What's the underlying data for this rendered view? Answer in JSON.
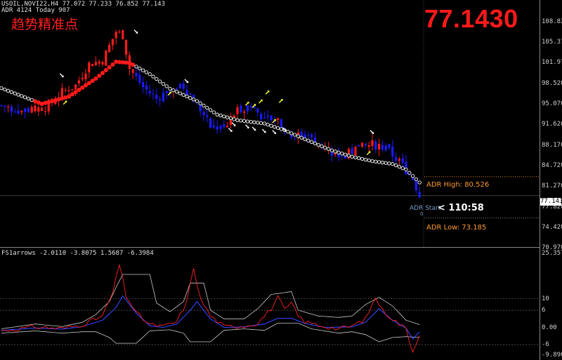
{
  "header": {
    "symbol_line": "USOIL,NOVI22,H4  77.072 77.233 76.852 77.143",
    "adr_line": "ADR 4124  Today 907",
    "indicator_line": "FS1arrows -2.0110 -3.8075 1.5687 -6.3984"
  },
  "big_price": "77.1430",
  "chinese_title": "趋势精准点",
  "price_axis": {
    "ticks": [
      "108.820",
      "105.370",
      "101.970",
      "98.520",
      "95.070",
      "91.620",
      "88.170",
      "84.720",
      "81.270",
      "77.820",
      "74.420",
      "70.970"
    ],
    "ymin": 68.0,
    "ymax": 112.0,
    "current": "77.143"
  },
  "adr": {
    "high_label": "ADR High: 80.526",
    "high": 80.526,
    "low_label": "ADR Low: 73.185",
    "low": 73.185,
    "start_label": "ADR Start",
    "start_sub": "0",
    "timer": "< 110:58"
  },
  "indicator_axis": {
    "ticks": [
      "25.3573",
      "10",
      "6",
      "0.00",
      "-6",
      "-9.8902"
    ],
    "ymin": -9.8902,
    "ymax": 25.3573
  },
  "colors": {
    "bull": "#ff1a1a",
    "bear": "#1a1aff",
    "trail": "#ffffff",
    "yellow": "#ffff33",
    "adr": "#ff9a2e"
  },
  "chart_data": {
    "type": "line",
    "title": "USOIL,NOVI22,H4",
    "close_anchors": [
      [
        0,
        93.2
      ],
      [
        6,
        92.3
      ],
      [
        10,
        92.6
      ],
      [
        14,
        93.1
      ],
      [
        18,
        95.6
      ],
      [
        22,
        96.8
      ],
      [
        26,
        100.6
      ],
      [
        30,
        101.2
      ],
      [
        34,
        106.4
      ],
      [
        36,
        105.7
      ],
      [
        38,
        99.8
      ],
      [
        42,
        96.5
      ],
      [
        46,
        94.4
      ],
      [
        50,
        96.2
      ],
      [
        54,
        96.6
      ],
      [
        58,
        93.6
      ],
      [
        62,
        89.4
      ],
      [
        66,
        89.0
      ],
      [
        70,
        92.5
      ],
      [
        74,
        93.2
      ],
      [
        78,
        90.8
      ],
      [
        82,
        90.2
      ],
      [
        86,
        88.2
      ],
      [
        90,
        87.6
      ],
      [
        94,
        86.6
      ],
      [
        98,
        84.7
      ],
      [
        102,
        84.4
      ],
      [
        106,
        85.6
      ],
      [
        110,
        86.3
      ],
      [
        114,
        85.6
      ],
      [
        118,
        83.2
      ],
      [
        122,
        80.2
      ],
      [
        124,
        77.1
      ]
    ],
    "trail_anchors": [
      [
        0,
        96.3
      ],
      [
        12,
        93.5
      ],
      [
        20,
        94.8
      ],
      [
        28,
        98.0
      ],
      [
        34,
        101.0
      ],
      [
        38,
        100.8
      ],
      [
        44,
        98.8
      ],
      [
        50,
        96.2
      ],
      [
        58,
        94.0
      ],
      [
        64,
        91.6
      ],
      [
        70,
        90.6
      ],
      [
        78,
        90.0
      ],
      [
        84,
        88.8
      ],
      [
        90,
        87.2
      ],
      [
        98,
        85.2
      ],
      [
        104,
        84.1
      ],
      [
        110,
        83.3
      ],
      [
        116,
        82.8
      ],
      [
        120,
        81.8
      ],
      [
        124,
        79.5
      ]
    ],
    "red_segment": [
      10,
      39
    ],
    "indicator": {
      "red_anchors": [
        [
          0,
          -1.2
        ],
        [
          10,
          0.2
        ],
        [
          18,
          -0.4
        ],
        [
          24,
          1.0
        ],
        [
          30,
          4.0
        ],
        [
          33,
          12.0
        ],
        [
          35,
          22.0
        ],
        [
          37,
          11.0
        ],
        [
          40,
          5.0
        ],
        [
          44,
          1.0
        ],
        [
          48,
          0.3
        ],
        [
          52,
          2.0
        ],
        [
          55,
          9.0
        ],
        [
          57,
          21.0
        ],
        [
          59,
          10.0
        ],
        [
          62,
          4.0
        ],
        [
          66,
          0.3
        ],
        [
          72,
          0.5
        ],
        [
          76,
          1.5
        ],
        [
          80,
          6.5
        ],
        [
          82,
          10.5
        ],
        [
          84,
          6.0
        ],
        [
          86,
          8.5
        ],
        [
          88,
          4.0
        ],
        [
          90,
          2.0
        ],
        [
          94,
          0.8
        ],
        [
          100,
          -0.6
        ],
        [
          104,
          0.5
        ],
        [
          108,
          3.0
        ],
        [
          111,
          10.5
        ],
        [
          113,
          6.0
        ],
        [
          116,
          3.0
        ],
        [
          120,
          -0.5
        ],
        [
          122,
          -8.5
        ],
        [
          124,
          -2.0
        ]
      ],
      "blue_anchors": [
        [
          0,
          -1.0
        ],
        [
          10,
          -0.2
        ],
        [
          18,
          -0.6
        ],
        [
          24,
          0.3
        ],
        [
          30,
          2.5
        ],
        [
          34,
          7.0
        ],
        [
          36,
          11.0
        ],
        [
          40,
          5.0
        ],
        [
          44,
          0.6
        ],
        [
          48,
          0.0
        ],
        [
          52,
          1.2
        ],
        [
          56,
          6.0
        ],
        [
          58,
          9.0
        ],
        [
          62,
          3.0
        ],
        [
          66,
          0.0
        ],
        [
          72,
          0.2
        ],
        [
          78,
          1.2
        ],
        [
          82,
          3.2
        ],
        [
          86,
          3.2
        ],
        [
          90,
          1.4
        ],
        [
          96,
          0.0
        ],
        [
          104,
          0.2
        ],
        [
          108,
          1.8
        ],
        [
          112,
          6.5
        ],
        [
          116,
          2.5
        ],
        [
          120,
          -0.3
        ],
        [
          122,
          -4.0
        ],
        [
          124,
          -1.5
        ]
      ],
      "upper_anchors": [
        [
          0,
          -0.5
        ],
        [
          10,
          1.2
        ],
        [
          18,
          0.3
        ],
        [
          24,
          1.8
        ],
        [
          28,
          4.5
        ],
        [
          32,
          9.0
        ],
        [
          34,
          14.0
        ],
        [
          36,
          18.5
        ],
        [
          44,
          18.5
        ],
        [
          46,
          8.5
        ],
        [
          50,
          5.5
        ],
        [
          54,
          9.0
        ],
        [
          56,
          15.5
        ],
        [
          60,
          15.5
        ],
        [
          62,
          6.0
        ],
        [
          66,
          3.0
        ],
        [
          72,
          3.0
        ],
        [
          76,
          6.5
        ],
        [
          80,
          11.5
        ],
        [
          86,
          12.5
        ],
        [
          88,
          6.0
        ],
        [
          94,
          4.0
        ],
        [
          100,
          3.5
        ],
        [
          104,
          4.0
        ],
        [
          108,
          8.0
        ],
        [
          112,
          10.5
        ],
        [
          116,
          7.5
        ],
        [
          120,
          2.5
        ],
        [
          124,
          1.0
        ]
      ],
      "lower_anchors": [
        [
          0,
          -2.0
        ],
        [
          10,
          -1.2
        ],
        [
          18,
          -2.0
        ],
        [
          24,
          -1.5
        ],
        [
          28,
          -1.5
        ],
        [
          32,
          -3.5
        ],
        [
          34,
          -5.5
        ],
        [
          40,
          -5.5
        ],
        [
          44,
          -1.2
        ],
        [
          50,
          -0.8
        ],
        [
          54,
          -2.0
        ],
        [
          56,
          -5.0
        ],
        [
          62,
          -5.0
        ],
        [
          66,
          -1.0
        ],
        [
          72,
          -0.5
        ],
        [
          78,
          -1.0
        ],
        [
          82,
          1.5
        ],
        [
          88,
          1.5
        ],
        [
          92,
          -0.5
        ],
        [
          100,
          -2.0
        ],
        [
          104,
          -1.5
        ],
        [
          108,
          -2.5
        ],
        [
          112,
          -5.0
        ],
        [
          116,
          -3.5
        ],
        [
          120,
          -3.2
        ],
        [
          124,
          -3.5
        ]
      ]
    }
  }
}
